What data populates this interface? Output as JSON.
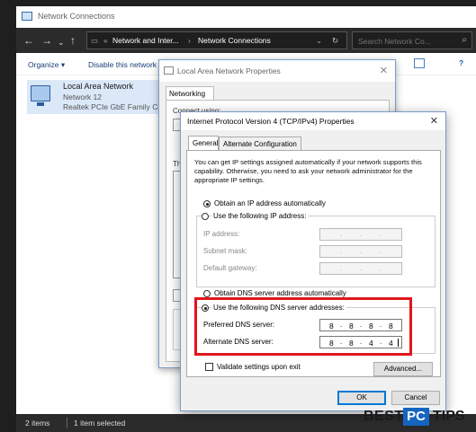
{
  "explorer": {
    "title": "Network Connections",
    "breadcrumb_sep": "«",
    "breadcrumb": [
      "Network and Inter...",
      "Network Connections"
    ],
    "search_placeholder": "Search Network Co...",
    "toolbar": {
      "organize": "Organize ▾",
      "disable": "Disable this network"
    },
    "item": {
      "name": "Local Area Network",
      "network": "Network 12",
      "adapter": "Realtek PCIe GbE Family Co"
    },
    "status": {
      "items": "2 items",
      "selected": "1 item selected"
    }
  },
  "props": {
    "title": "Local Area Network Properties",
    "tab": "Networking",
    "frag_connect": "Connect using:",
    "frag_this": "Th"
  },
  "ipv4": {
    "title": "Internet Protocol Version 4 (TCP/IPv4) Properties",
    "tabs": [
      "General",
      "Alternate Configuration"
    ],
    "description": "You can get IP settings assigned automatically if your network supports this capability. Otherwise, you need to ask your network administrator for the appropriate IP settings.",
    "ip_auto": "Obtain an IP address automatically",
    "ip_manual": "Use the following IP address:",
    "ip_address": "IP address:",
    "subnet": "Subnet mask:",
    "gateway": "Default gateway:",
    "dns_auto": "Obtain DNS server address automatically",
    "dns_manual": "Use the following DNS server addresses:",
    "preferred_label": "Preferred DNS server:",
    "alternate_label": "Alternate DNS server:",
    "preferred": [
      "8",
      "8",
      "8",
      "8"
    ],
    "alternate": [
      "8",
      "8",
      "4",
      "4"
    ],
    "validate": "Validate settings upon exit",
    "advanced": "Advanced...",
    "ok": "OK",
    "cancel": "Cancel",
    "dot": "."
  },
  "watermark": {
    "left": "BEST",
    "mid": "PC",
    "right": "TIPS"
  },
  "colors": {
    "highlight": "#e0161b",
    "selection": "#dbe8f8",
    "dark_bar": "#2b2b2b"
  }
}
